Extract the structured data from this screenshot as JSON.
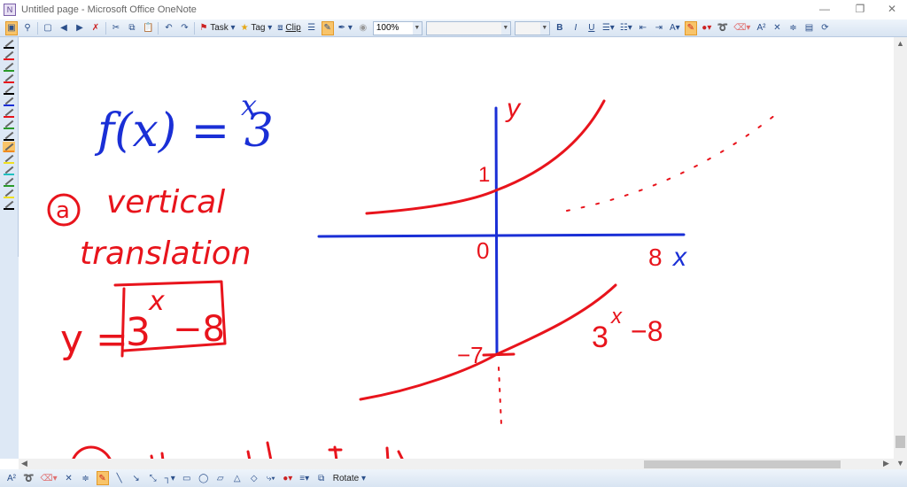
{
  "window": {
    "title": "Untitled page - Microsoft Office OneNote",
    "minimize": "—",
    "restore": "❐",
    "close": "✕"
  },
  "toolbar": {
    "task_label": "Task",
    "tag_label": "Tag",
    "clip_label": "Clip",
    "zoom_value": "100%",
    "font_value": "",
    "size_value": "",
    "bold": "B",
    "italic": "I",
    "underline": "U",
    "superscript": "A²"
  },
  "drawing_toolbar": {
    "rotate_label": "Rotate",
    "text_tool": "A²"
  },
  "note": {
    "function_def": "f(x) = 3^x",
    "part_a_label": "a",
    "part_a_title": "vertical translation",
    "answer": "y = 3^x − 8",
    "axis_y": "y",
    "axis_x": "x",
    "origin": "0",
    "y_tick": "1",
    "x_intercept": "8",
    "y_intercept": "−7",
    "curve_label": "3^x − 8"
  },
  "colors": {
    "ink_red": "#e8141c",
    "ink_blue": "#1a2fd6",
    "toolbar_bg": "#dde8f5",
    "highlight": "#f8c46a"
  },
  "pens": [
    "#000000",
    "#e8141c",
    "#2a9a2a",
    "#e8141c",
    "#000000",
    "#1a2fd6",
    "#e8141c",
    "#2a9a2a",
    "#000000",
    "#f08a20",
    "#f0e020",
    "#20c0c0",
    "#2a9a2a",
    "#f0e020",
    "#000000"
  ]
}
